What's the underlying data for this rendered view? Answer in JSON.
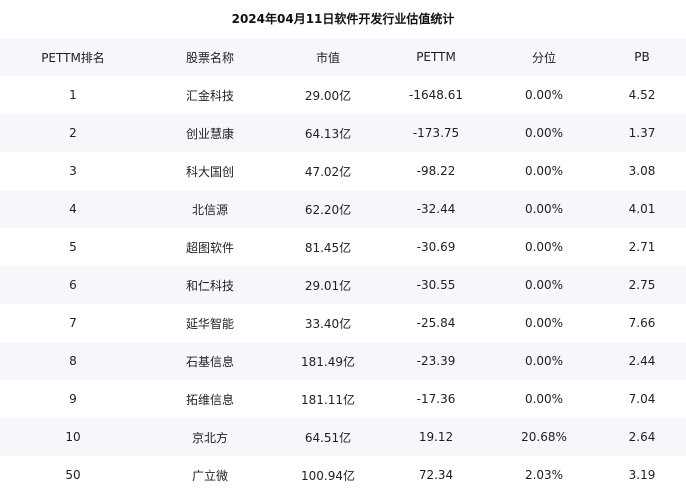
{
  "title": "2024年04月11日软件开发行业估值统计",
  "table": {
    "headers": [
      "PETTM排名",
      "股票名称",
      "市值",
      "PETTM",
      "分位",
      "PB"
    ],
    "rows": [
      [
        "1",
        "汇金科技",
        "29.00亿",
        "-1648.61",
        "0.00%",
        "4.52"
      ],
      [
        "2",
        "创业慧康",
        "64.13亿",
        "-173.75",
        "0.00%",
        "1.37"
      ],
      [
        "3",
        "科大国创",
        "47.02亿",
        "-98.22",
        "0.00%",
        "3.08"
      ],
      [
        "4",
        "北信源",
        "62.20亿",
        "-32.44",
        "0.00%",
        "4.01"
      ],
      [
        "5",
        "超图软件",
        "81.45亿",
        "-30.69",
        "0.00%",
        "2.71"
      ],
      [
        "6",
        "和仁科技",
        "29.01亿",
        "-30.55",
        "0.00%",
        "2.75"
      ],
      [
        "7",
        "延华智能",
        "33.40亿",
        "-25.84",
        "0.00%",
        "7.66"
      ],
      [
        "8",
        "石基信息",
        "181.49亿",
        "-23.39",
        "0.00%",
        "2.44"
      ],
      [
        "9",
        "拓维信息",
        "181.11亿",
        "-17.36",
        "0.00%",
        "7.04"
      ],
      [
        "10",
        "京北方",
        "64.51亿",
        "19.12",
        "20.68%",
        "2.64"
      ],
      [
        "50",
        "广立微",
        "100.94亿",
        "72.34",
        "2.03%",
        "3.19"
      ]
    ]
  }
}
